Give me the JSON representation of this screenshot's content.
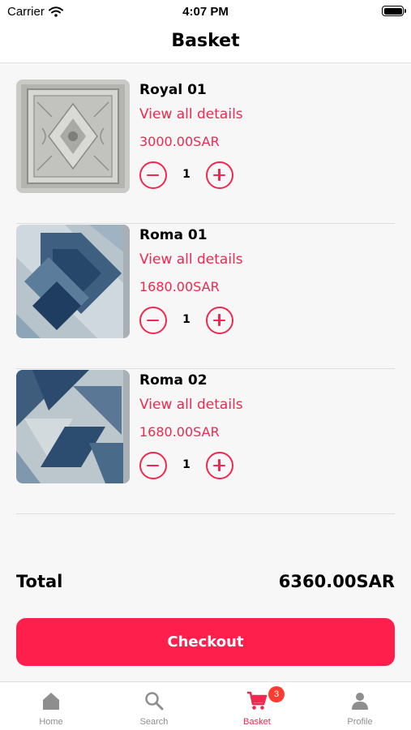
{
  "status_bar": {
    "carrier": "Carrier",
    "time": "4:07 PM"
  },
  "header": {
    "title": "Basket"
  },
  "items": [
    {
      "name": "Royal 01",
      "details_link": "View all details",
      "price": "3000.00SAR",
      "quantity": "1"
    },
    {
      "name": "Roma 01",
      "details_link": "View all details",
      "price": "1680.00SAR",
      "quantity": "1"
    },
    {
      "name": "Roma 02",
      "details_link": "View all details",
      "price": "1680.00SAR",
      "quantity": "1"
    }
  ],
  "summary": {
    "total_label": "Total",
    "total_value": "6360.00SAR"
  },
  "checkout": {
    "label": "Checkout"
  },
  "tabs": [
    {
      "label": "Home",
      "icon": "home-icon"
    },
    {
      "label": "Search",
      "icon": "search-icon"
    },
    {
      "label": "Basket",
      "icon": "cart-icon",
      "badge": "3"
    },
    {
      "label": "Profile",
      "icon": "profile-icon"
    }
  ],
  "active_tab": "Basket",
  "colors": {
    "accent": "#f0284f",
    "checkout_button": "#ff1f4c",
    "badge": "#ff3b30",
    "inactive_tab": "#8e8e8e"
  }
}
